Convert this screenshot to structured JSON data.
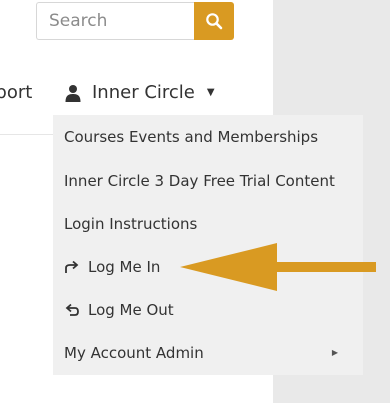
{
  "search": {
    "placeholder": "Search"
  },
  "nav": {
    "items": [
      {
        "label": "pport"
      },
      {
        "label": "Inner Circle"
      }
    ]
  },
  "dropdown": {
    "items": [
      {
        "label": "Courses Events and Memberships"
      },
      {
        "label": "Inner Circle 3 Day Free Trial Content"
      },
      {
        "label": "Login Instructions"
      },
      {
        "label": "Log Me In",
        "icon": "share-arrow-icon"
      },
      {
        "label": "Log Me Out",
        "icon": "undo-arrow-icon"
      },
      {
        "label": "My Account Admin",
        "has_submenu": true
      }
    ]
  },
  "colors": {
    "accent": "#d99a22",
    "annotation_arrow": "#d99a22",
    "dropdown_bg": "#f0f0f0",
    "side_panel": "#e9e9e9"
  }
}
